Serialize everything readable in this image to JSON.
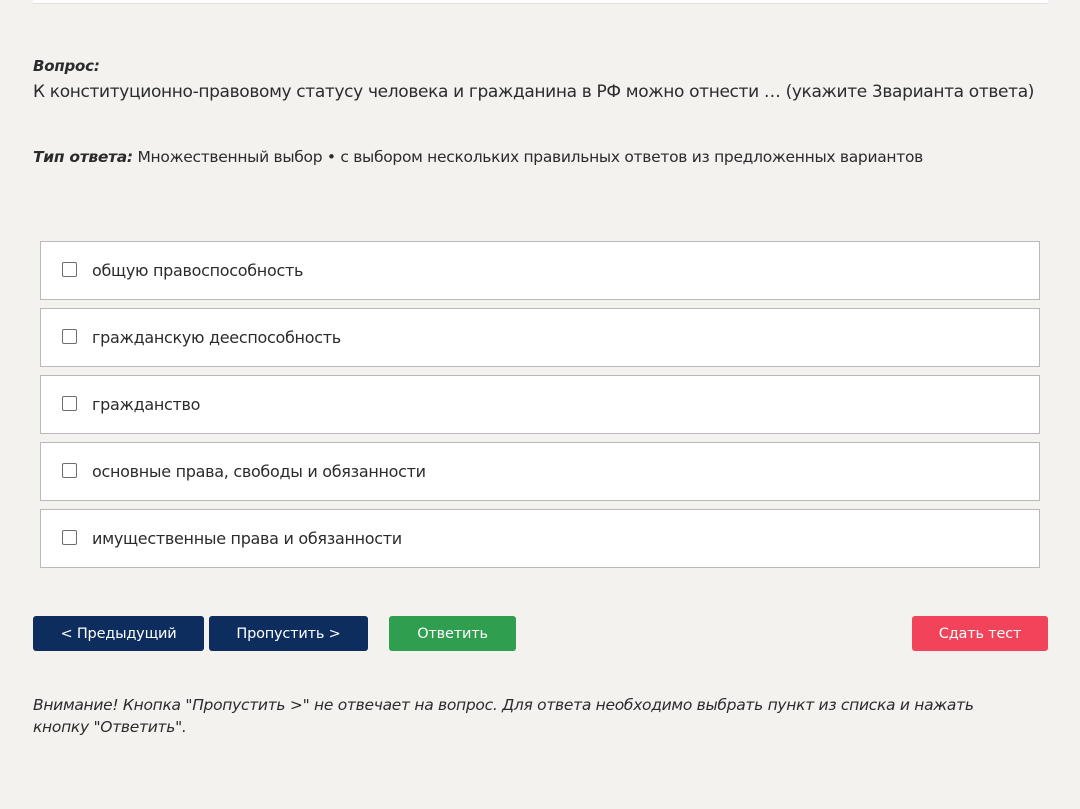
{
  "question": {
    "label": "Вопрос:",
    "text": "К конституционно-правовому статусу человека и гражданина в РФ можно отнести … (укажите 3варианта ответа)"
  },
  "answer_type": {
    "label": "Тип ответа:",
    "value": "Множественный выбор • с выбором нескольких правильных ответов из предложенных вариантов"
  },
  "options": [
    {
      "text": "общую правоспособность",
      "checked": false
    },
    {
      "text": "гражданскую дееспособность",
      "checked": false
    },
    {
      "text": "гражданство",
      "checked": false
    },
    {
      "text": "основные права, свободы и обязанности",
      "checked": false
    },
    {
      "text": "имущественные права и обязанности",
      "checked": false
    }
  ],
  "buttons": {
    "prev": "< Предыдущий",
    "skip": "Пропустить >",
    "answer": "Ответить",
    "finish": "Сдать тест"
  },
  "notice": "Внимание! Кнопка \"Пропустить >\" не отвечает на вопрос. Для ответа необходимо выбрать пункт из списка и нажать кнопку \"Ответить\".",
  "colors": {
    "background": "#f3f2ef",
    "nav_button": "#0d2d5e",
    "answer_button": "#2f9e4e",
    "finish_button": "#f1435a"
  }
}
